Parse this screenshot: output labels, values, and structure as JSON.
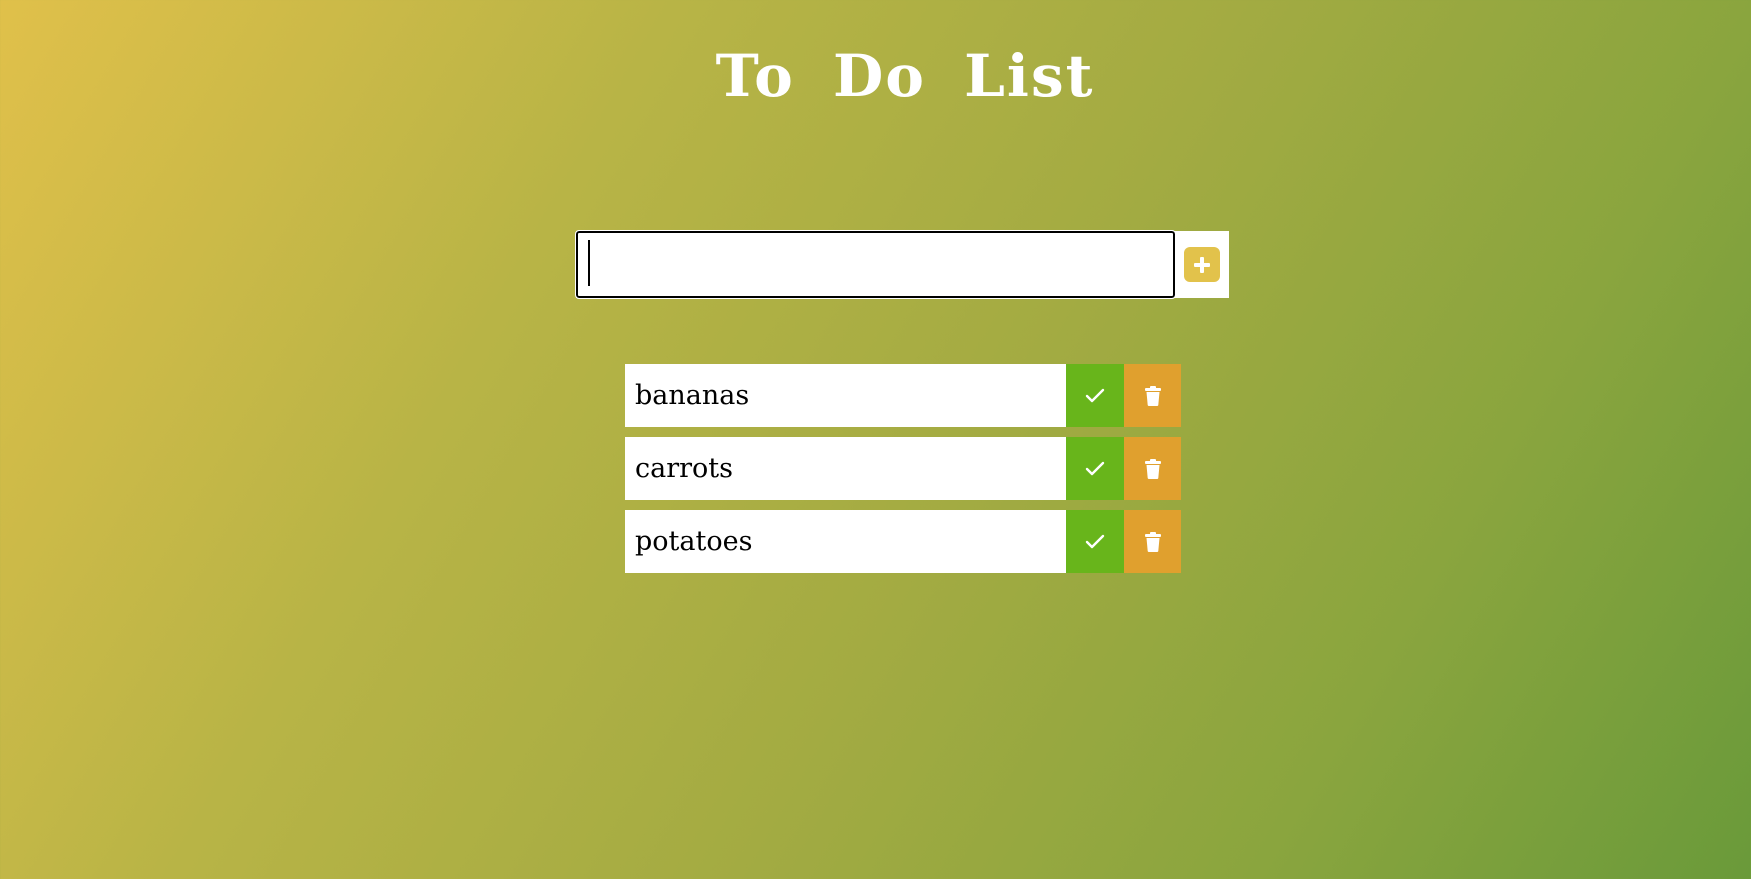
{
  "title": "To Do List",
  "input": {
    "value": "",
    "placeholder": ""
  },
  "add_button": {
    "icon": "plus-icon",
    "color": "#e2c24b"
  },
  "todos": [
    {
      "text": "bananas",
      "done_icon": "check-icon",
      "delete_icon": "trash-icon"
    },
    {
      "text": "carrots",
      "done_icon": "check-icon",
      "delete_icon": "trash-icon"
    },
    {
      "text": "potatoes",
      "done_icon": "check-icon",
      "delete_icon": "trash-icon"
    }
  ],
  "colors": {
    "done": "#68b51b",
    "delete": "#e0a02e",
    "gradient_start": "#e0c04a",
    "gradient_end": "#6a9a3a"
  }
}
